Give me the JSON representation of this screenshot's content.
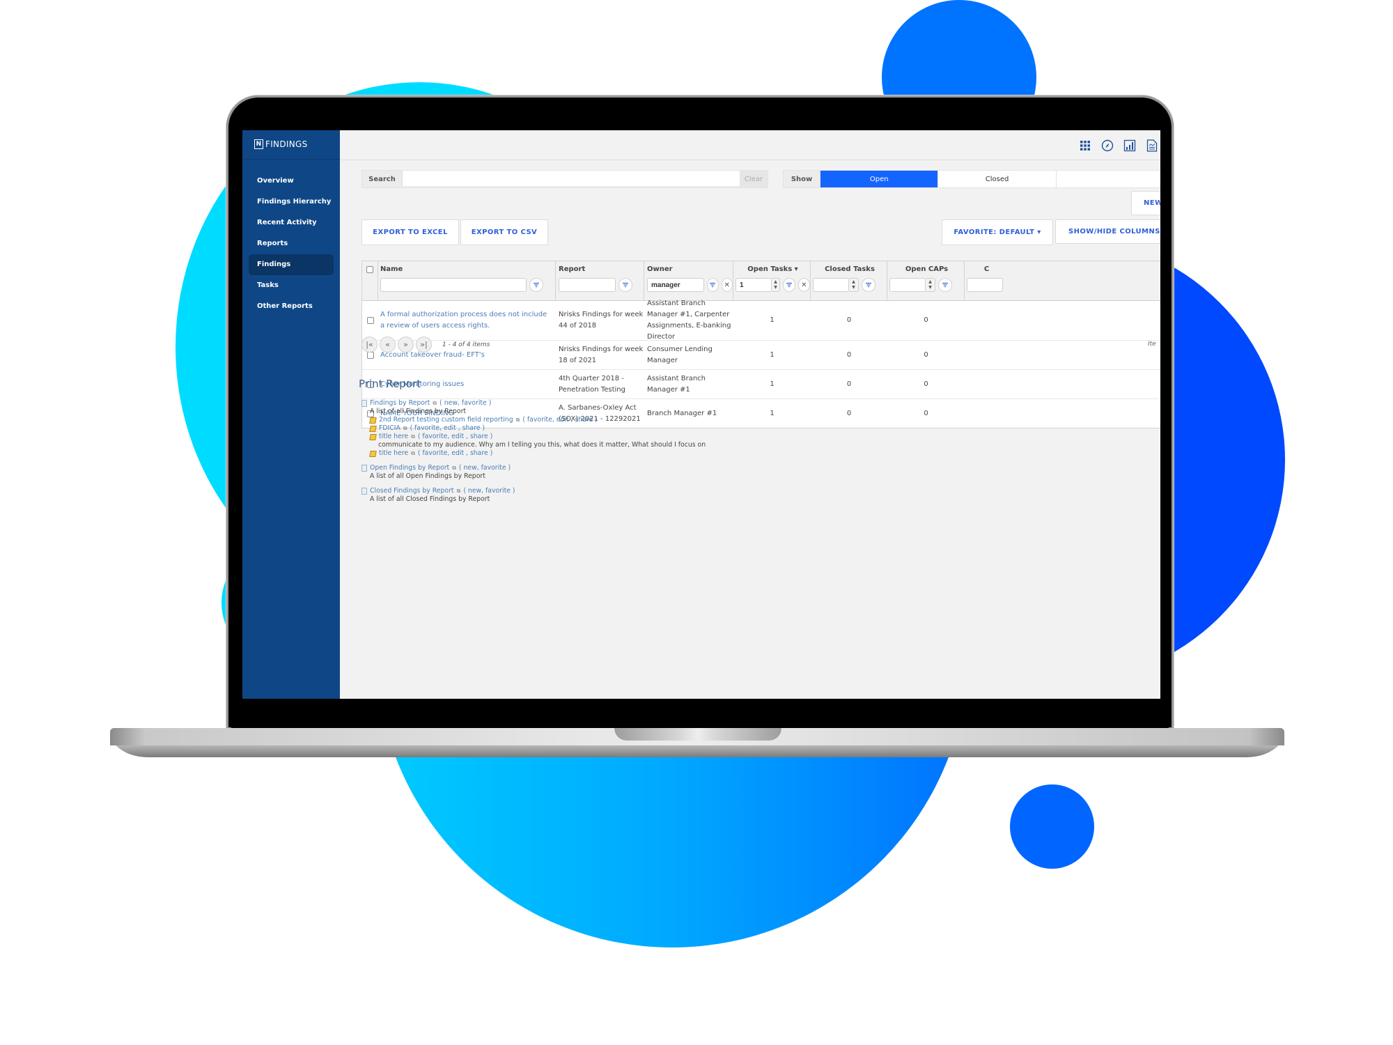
{
  "colors": {
    "sidebar_bg": "#0f4786",
    "sidebar_active": "#0a3565",
    "accent": "#1464ff",
    "button_text": "#2f5fd6",
    "link": "#4a7db4"
  },
  "app": {
    "brand_letter": "N",
    "brand_name": "FINDINGS"
  },
  "sidebar": {
    "items": [
      {
        "label": "Overview"
      },
      {
        "label": "Findings Hierarchy"
      },
      {
        "label": "Recent Activity"
      },
      {
        "label": "Reports"
      },
      {
        "label": "Findings",
        "active": true
      },
      {
        "label": "Tasks"
      },
      {
        "label": "Other Reports"
      }
    ]
  },
  "topbar": {
    "icons": [
      "apps-grid-icon",
      "compass-icon",
      "bar-chart-icon",
      "document-chart-icon"
    ]
  },
  "search": {
    "label": "Search",
    "value": "",
    "placeholder": "",
    "clear_label": "Clear"
  },
  "show": {
    "label": "Show",
    "options": [
      "Open",
      "Closed",
      ""
    ],
    "selected": "Open"
  },
  "toolbar": {
    "new_label": "NEW",
    "export_excel": "EXPORT TO EXCEL",
    "export_csv": "EXPORT TO CSV",
    "favorite": "FAVORITE: DEFAULT ▾",
    "show_hide_columns": "SHOW/HIDE COLUMNS"
  },
  "grid": {
    "columns": {
      "name": "Name",
      "report": "Report",
      "owner": "Owner",
      "open_tasks": "Open Tasks ▾",
      "closed_tasks": "Closed Tasks",
      "open_caps": "Open CAPs",
      "more": "C"
    },
    "filters": {
      "name": "",
      "report": "",
      "owner": "manager",
      "open_tasks": "1",
      "closed_tasks": "",
      "open_caps": "",
      "more": ""
    },
    "rows": [
      {
        "name": "A formal authorization process does not include a review of users access rights.",
        "report": "Nrisks Findings for week 44 of 2018",
        "owner": "Assistant Branch Manager #1, Carpenter Assignments, E-banking Director",
        "open_tasks": "1",
        "closed_tasks": "0",
        "open_caps": "0"
      },
      {
        "name": "Account takeover fraud- EFT's",
        "report": "Nrisks Findings for week 18 of 2021",
        "owner": "Consumer Lending Manager",
        "open_tasks": "1",
        "closed_tasks": "0",
        "open_caps": "0"
      },
      {
        "name": "Cyber Monitoring issues",
        "report": "4th Quarter 2018 - Penetration Testing",
        "owner": "Assistant Branch Manager #1",
        "open_tasks": "1",
        "closed_tasks": "0",
        "open_caps": "0"
      },
      {
        "name": "NAME YOUR FINDING",
        "report": "A. Sarbanes-Oxley Act (SOX) 2021 - 12292021",
        "owner": "Branch Manager #1",
        "open_tasks": "1",
        "closed_tasks": "0",
        "open_caps": "0"
      }
    ]
  },
  "pager": {
    "first": "|«",
    "prev": "«",
    "next": "»",
    "last": "»|",
    "info": "1 - 4 of 4 items",
    "items_per_page_label": "Ite"
  },
  "print_report": {
    "title": "Print Report",
    "groups": [
      {
        "link": "Findings by Report",
        "actions": "( new, favorite )",
        "description": "A list of all Findings by Report",
        "subitems": [
          {
            "link": "2nd Report testing custom field reporting",
            "actions": "( favorite, edit , share )",
            "description": ""
          },
          {
            "link": "FDICIA",
            "actions": "( favorite, edit , share )",
            "description": ""
          },
          {
            "link": "title here",
            "actions": "( favorite, edit , share )",
            "description": "communicate to my audience. Why am I telling you this, what does it matter, What should I focus on"
          },
          {
            "link": "title here",
            "actions": "( favorite, edit , share )",
            "description": ""
          }
        ]
      },
      {
        "link": "Open Findings by Report",
        "actions": "( new, favorite )",
        "description": "A list of all Open Findings by Report",
        "subitems": []
      },
      {
        "link": "Closed Findings by Report",
        "actions": "( new, favorite )",
        "description": "A list of all Closed Findings by Report",
        "subitems": []
      }
    ]
  }
}
